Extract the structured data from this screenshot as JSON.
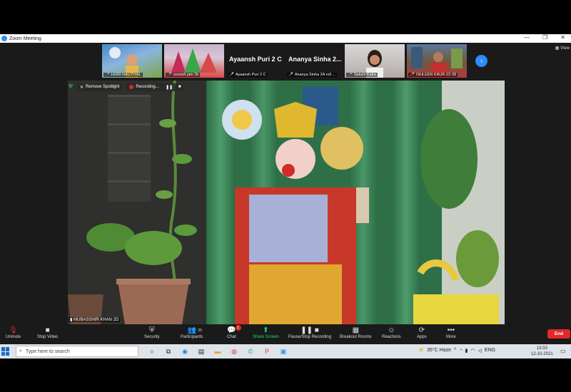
{
  "window": {
    "title": "Zoom Meeting",
    "controls": [
      "—",
      "❐",
      "✕"
    ]
  },
  "view_label": "View",
  "strip": {
    "tiles": [
      {
        "caption": "HORI NAUTIYAL",
        "big_name": "",
        "colors": [
          "#4a88c9",
          "#7ca64a"
        ]
      },
      {
        "caption": "sourish jain 2b",
        "big_name": "",
        "colors": [
          "#c8b2c8",
          "#d64a4a"
        ]
      },
      {
        "caption": "Ayaansh Puri 2 C",
        "big_name": "Ayaansh Puri 2 C"
      },
      {
        "caption": "Ananya  Sinha 2A roll ...",
        "big_name": "Ananya  Sinha 2..."
      },
      {
        "caption": "Sakshi Kalra",
        "big_name": "",
        "colors": [
          "#d8d8d8",
          "#b0a8a6"
        ]
      },
      {
        "caption": "ISHLEEN KAUR-22-28",
        "big_name": "",
        "colors": [
          "#5a7aa0",
          "#b23a3a"
        ]
      }
    ],
    "next_icon": "chevron-right-icon"
  },
  "spotlight_bar": {
    "remove_spotlight": "Remove Spotlight",
    "recording": "Recording..."
  },
  "video_main_name": "MUBASSHIR KHAN 2D",
  "toolbar": {
    "unmute": "Unmute",
    "stop_video": "Stop Video",
    "security": "Security",
    "participants": "Participants",
    "participants_count": "25",
    "chat": "Chat",
    "chat_badge": "1",
    "share_screen": "Share Screen",
    "recording": "Pause/Stop Recording",
    "breakout": "Breakout Rooms",
    "reactions": "Reactions",
    "apps": "Apps",
    "more": "More",
    "end": "End"
  },
  "taskbar": {
    "search_placeholder": "Type here to search",
    "weather": "35°C  Haze",
    "lang": "ENG",
    "time": "13:33",
    "date": "12-10-2021"
  }
}
